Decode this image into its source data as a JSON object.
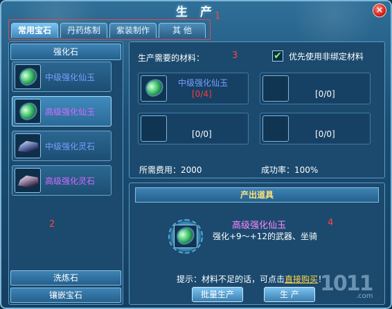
{
  "window": {
    "title": "生 产",
    "close_glyph": "✕",
    "markers": [
      "1",
      "2",
      "3",
      "4"
    ]
  },
  "tabs": [
    {
      "label": "常用宝石",
      "active": true
    },
    {
      "label": "丹药炼制",
      "active": false
    },
    {
      "label": "紫装制作",
      "active": false
    },
    {
      "label": "其  他",
      "active": false
    }
  ],
  "sidebar": {
    "category_header": "强化石",
    "items": [
      {
        "label": "中级强化仙玉",
        "color": "blue",
        "icon": "green-gem-icon",
        "selected": false
      },
      {
        "label": "高级强化仙玉",
        "color": "purple",
        "icon": "green-gem-icon",
        "selected": true
      },
      {
        "label": "中级强化灵石",
        "color": "blue",
        "icon": "stone-icon",
        "selected": false
      },
      {
        "label": "高级强化灵石",
        "color": "purple",
        "icon": "stone-icon",
        "selected": false
      }
    ],
    "bottom_buttons": [
      "洗炼石",
      "镶嵌宝石"
    ]
  },
  "materials": {
    "title": "生产需要的材料：",
    "prefer_checked": true,
    "prefer_label": "优先使用非绑定材料",
    "check_glyph": "✔",
    "slots": [
      {
        "name": "中级强化仙玉",
        "count": "[0/4]",
        "has_item": true
      },
      {
        "name": "",
        "count": "[0/0]",
        "has_item": false
      },
      {
        "name": "",
        "count": "[0/0]",
        "has_item": false
      },
      {
        "name": "",
        "count": "[0/0]",
        "has_item": false
      }
    ],
    "cost": "所需费用：2000",
    "success_rate": "成功率：100%"
  },
  "output": {
    "header": "产出道具",
    "item_name": "高级强化仙玉",
    "item_desc": "强化+9～+12的武器、坐骑",
    "hint_prefix": "提示：材料不足的话，可点击",
    "hint_link": "直接购买",
    "hint_suffix": "！",
    "batch_button": "批量生产",
    "produce_button": "生  产"
  },
  "watermark": {
    "number": "1011",
    "domain": ".com"
  },
  "colors": {
    "accent": "#7fb6d8",
    "purple_item": "#d56aff",
    "blue_item": "#7aa0ff",
    "output_name": "#ff87ff",
    "warning_red": "#ff3b3b",
    "link_gold": "#ffd34a"
  }
}
